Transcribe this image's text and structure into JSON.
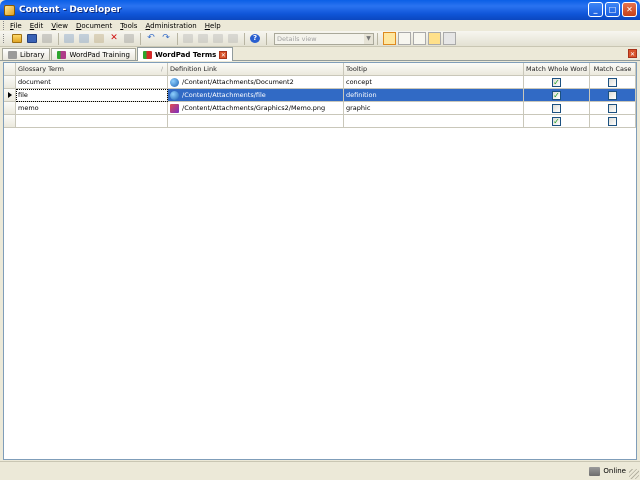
{
  "window": {
    "title": "Content - Developer",
    "buttons": {
      "minimize": "_",
      "maximize": "□",
      "close": "✕"
    }
  },
  "menu": [
    "File",
    "Edit",
    "View",
    "Document",
    "Tools",
    "Administration",
    "Help"
  ],
  "toolbar": {
    "view_select": "Details view",
    "icons": [
      "open-folder-icon",
      "save-icon",
      "print-icon",
      "cut-icon",
      "copy-icon",
      "paste-icon",
      "delete-icon",
      "properties-icon",
      "undo-icon",
      "redo-icon",
      "bold-icon",
      "italic-icon",
      "indent-icon",
      "outdent-icon",
      "help-icon"
    ]
  },
  "tabs": [
    {
      "label": "Library",
      "icon": "library-icon",
      "active": false
    },
    {
      "label": "WordPad Training",
      "icon": "checked-document-icon",
      "active": false
    },
    {
      "label": "WordPad Terms",
      "icon": "checked-terms-icon",
      "active": true
    }
  ],
  "grid": {
    "columns": [
      "Glossary Term",
      "Definition Link",
      "Tooltip",
      "Match Whole Word",
      "Match Case"
    ],
    "rows": [
      {
        "term": "document",
        "link": "/Content/Attachments/Document2",
        "link_icon": "globe-icon",
        "tooltip": "concept",
        "whole_word": true,
        "match_case": false,
        "selected": false
      },
      {
        "term": "file",
        "link": "/Content/Attachments/file",
        "link_icon": "globe-icon",
        "tooltip": "definition",
        "whole_word": true,
        "match_case": false,
        "selected": true
      },
      {
        "term": "memo",
        "link": "/Content/Attachments/Graphics2/Memo.png",
        "link_icon": "image-icon",
        "tooltip": "graphic",
        "whole_word": false,
        "match_case": false,
        "selected": false
      },
      {
        "term": "",
        "link": "",
        "link_icon": "",
        "tooltip": "",
        "whole_word": true,
        "match_case": false,
        "selected": false
      }
    ]
  },
  "status": {
    "text": "Online",
    "icon": "network-icon"
  },
  "colors": {
    "title_bar": "#0a5fe6",
    "selection": "#316ac5",
    "chrome": "#ece9d8"
  }
}
